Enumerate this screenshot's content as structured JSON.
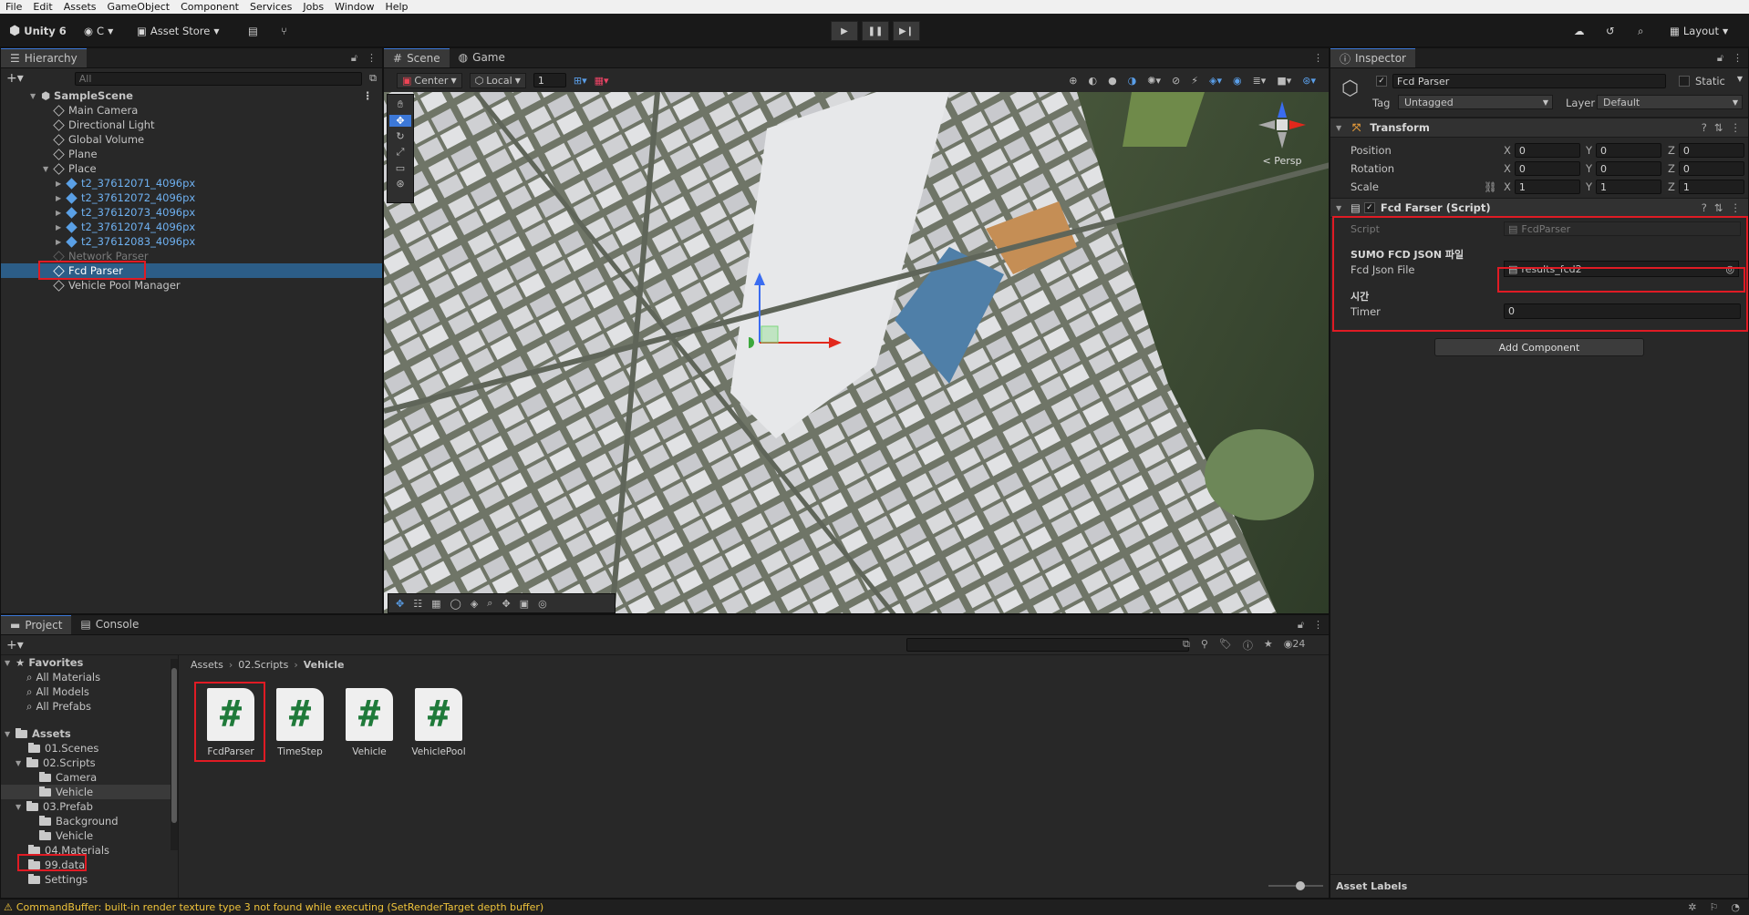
{
  "menu": [
    "File",
    "Edit",
    "Assets",
    "GameObject",
    "Component",
    "Services",
    "Jobs",
    "Window",
    "Help"
  ],
  "toolbar": {
    "app": "Unity 6",
    "account": "C",
    "asset_store": "Asset Store",
    "layout": "Layout"
  },
  "hierarchy": {
    "tab": "Hierarchy",
    "search_placeholder": "All",
    "scene": "SampleScene",
    "items": [
      {
        "label": "Main Camera"
      },
      {
        "label": "Directional Light"
      },
      {
        "label": "Global Volume"
      },
      {
        "label": "Plane"
      },
      {
        "label": "Place"
      },
      {
        "label": "t2_37612071_4096px"
      },
      {
        "label": "t2_37612072_4096px"
      },
      {
        "label": "t2_37612073_4096px"
      },
      {
        "label": "t2_37612074_4096px"
      },
      {
        "label": "t2_37612083_4096px"
      },
      {
        "label": "Network Parser"
      },
      {
        "label": "Fcd Parser"
      },
      {
        "label": "Vehicle Pool Manager"
      }
    ]
  },
  "scene_view": {
    "tabs": [
      "Scene",
      "Game"
    ],
    "pivot": "Center",
    "space": "Local",
    "grid_value": "1",
    "persp": "< Persp"
  },
  "inspector": {
    "tab": "Inspector",
    "object_name": "Fcd Parser",
    "static_label": "Static",
    "tag_label": "Tag",
    "tag_value": "Untagged",
    "layer_label": "Layer",
    "layer_value": "Default",
    "transform": {
      "title": "Transform",
      "position": {
        "label": "Position",
        "x": "0",
        "y": "0",
        "z": "0"
      },
      "rotation": {
        "label": "Rotation",
        "x": "0",
        "y": "0",
        "z": "0"
      },
      "scale": {
        "label": "Scale",
        "x": "1",
        "y": "1",
        "z": "1"
      }
    },
    "script_component": {
      "title": "Fcd Farser (Script)",
      "script_label": "Script",
      "script_value": "FcdParser",
      "section1": "SUMO FCD JSON 파일",
      "json_label": "Fcd Json File",
      "json_value": "results_fcd2",
      "section2": "시간",
      "timer_label": "Timer",
      "timer_value": "0"
    },
    "add_component": "Add Component",
    "asset_labels": "Asset Labels"
  },
  "project": {
    "tabs": [
      "Project",
      "Console"
    ],
    "count": "24",
    "breadcrumb": [
      "Assets",
      "02.Scripts",
      "Vehicle"
    ],
    "favorites": {
      "label": "Favorites",
      "items": [
        "All Materials",
        "All Models",
        "All Prefabs"
      ]
    },
    "assets_root": "Assets",
    "folders": [
      "01.Scenes",
      "02.Scripts",
      "Camera",
      "Vehicle",
      "03.Prefab",
      "Background",
      "Vehicle",
      "04.Materials",
      "99.data",
      "Settings"
    ],
    "files": [
      "FcdParser",
      "TimeStep",
      "Vehicle",
      "VehiclePool"
    ]
  },
  "status": {
    "message": "CommandBuffer: built-in render texture type 3 not found while executing  (SetRenderTarget depth buffer)"
  },
  "colors": {
    "accent": "#3c78d8",
    "highlight": "#e01b24",
    "selection": "#2c5d87",
    "warning": "#f0c43b"
  }
}
